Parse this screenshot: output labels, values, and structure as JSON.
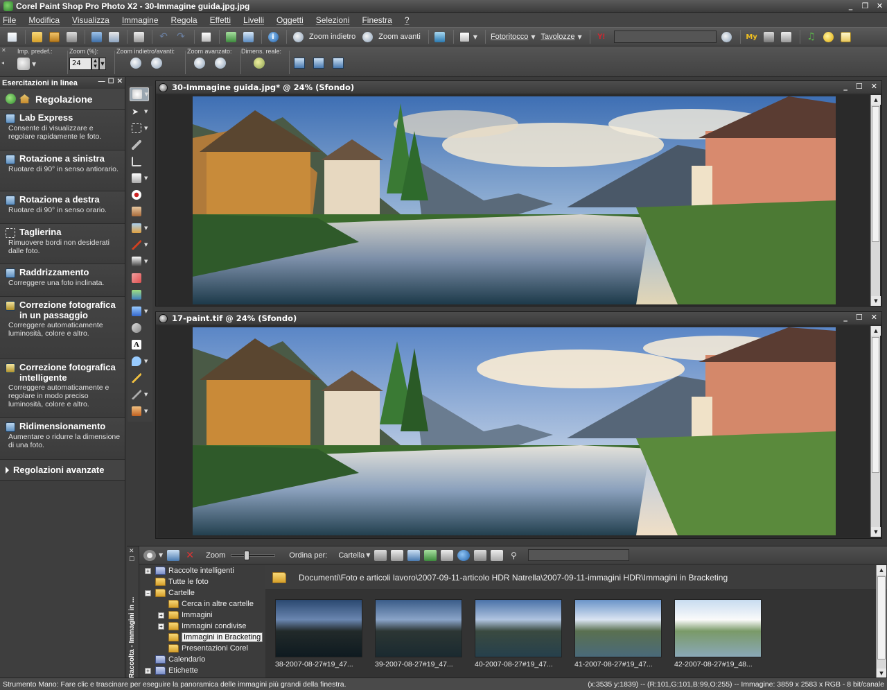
{
  "window": {
    "title": "Corel Paint Shop Pro Photo X2 - 30-Immagine guida.jpg.jpg",
    "minimize_glyph": "_",
    "restore_glyph": "❐",
    "close_glyph": "✕"
  },
  "menu": [
    "File",
    "Modifica",
    "Visualizza",
    "Immagine",
    "Regola",
    "Effetti",
    "Livelli",
    "Oggetti",
    "Selezioni",
    "Finestra",
    "?"
  ],
  "toolbar": {
    "zoom_out_label": "Zoom indietro",
    "zoom_in_label": "Zoom avanti",
    "fotoritocco_label": "Fotoritocco",
    "tavolozze_label": "Tavolozze",
    "yahoo_glyph": "Y!",
    "search_value": ""
  },
  "tool_options": {
    "preset_label": "Imp. predef.:",
    "zoom_pct_label": "Zoom (%):",
    "zoom_pct_value": "24",
    "zoom_in_out_label": "Zoom indietro/avanti:",
    "zoom_adv_label": "Zoom avanzato:",
    "actual_size_label": "Dimens. reale:"
  },
  "learning_center": {
    "panel_title": "Esercitazioni in linea",
    "section_title": "Regolazione",
    "items": [
      {
        "title": "Lab Express",
        "desc": "Consente di visualizzare e regolare rapidamente le foto."
      },
      {
        "title": "Rotazione a sinistra",
        "desc": "Ruotare di 90° in senso antiorario."
      },
      {
        "title": "Rotazione a destra",
        "desc": "Ruotare di 90° in senso orario."
      },
      {
        "title": "Taglierina",
        "desc": "Rimuovere bordi non desiderati dalle foto."
      },
      {
        "title": "Raddrizzamento",
        "desc": "Correggere una foto inclinata."
      },
      {
        "title": "Correzione fotografica in un passaggio",
        "desc": "Correggere automaticamente luminosità, colore e altro."
      },
      {
        "title": "Correzione fotografica intelligente",
        "desc": "Correggere automaticamente e regolare in modo preciso luminosità, colore e altro."
      },
      {
        "title": "Ridimensionamento",
        "desc": "Aumentare o ridurre la dimensione di una foto."
      }
    ],
    "advanced_label": "Regolazioni avanzate"
  },
  "image_windows": [
    {
      "title": "30-Immagine guida.jpg* @  24% (Sfondo)"
    },
    {
      "title": "17-paint.tif @  24% (Sfondo)"
    }
  ],
  "organizer": {
    "side_title": "Raccolta - Immagini in ...",
    "zoom_label": "Zoom",
    "sort_label": "Ordina per:",
    "sort_value": "Cartella",
    "search_value": "",
    "path": "Documenti\\Foto e articoli lavoro\\2007-09-11-articolo HDR Natrella\\2007-09-11-immagini HDR\\Immagini in Bracketing",
    "tree": [
      {
        "label": "Raccolte intelligenti",
        "expander": "+",
        "indent": 0,
        "type": "special"
      },
      {
        "label": "Tutte le foto",
        "expander": "",
        "indent": 0,
        "type": "folder"
      },
      {
        "label": "Cartelle",
        "expander": "−",
        "indent": 0,
        "type": "folder"
      },
      {
        "label": "Cerca in altre cartelle",
        "expander": "",
        "indent": 1,
        "type": "folder"
      },
      {
        "label": "Immagini",
        "expander": "+",
        "indent": 1,
        "type": "folder"
      },
      {
        "label": "Immagini condivise",
        "expander": "+",
        "indent": 1,
        "type": "folder"
      },
      {
        "label": "Immagini in Bracketing",
        "expander": "",
        "indent": 1,
        "type": "folder",
        "selected": true
      },
      {
        "label": "Presentazioni Corel",
        "expander": "",
        "indent": 1,
        "type": "folder"
      },
      {
        "label": "Calendario",
        "expander": "",
        "indent": 0,
        "type": "special"
      },
      {
        "label": "Etichette",
        "expander": "+",
        "indent": 0,
        "type": "special"
      }
    ],
    "thumbnails": [
      {
        "caption": "38-2007-08-27#19_47..."
      },
      {
        "caption": "39-2007-08-27#19_47..."
      },
      {
        "caption": "40-2007-08-27#19_47..."
      },
      {
        "caption": "41-2007-08-27#19_47..."
      },
      {
        "caption": "42-2007-08-27#19_48..."
      }
    ]
  },
  "status": {
    "left": "Strumento Mano: Fare clic e trascinare per eseguire la panoramica delle immagini più grandi della finestra.",
    "right": "(x:3535 y:1839) -- (R:101,G:101,B:99,O:255) -- Immagine:  3859 x 2583 x RGB - 8 bit/canale"
  }
}
